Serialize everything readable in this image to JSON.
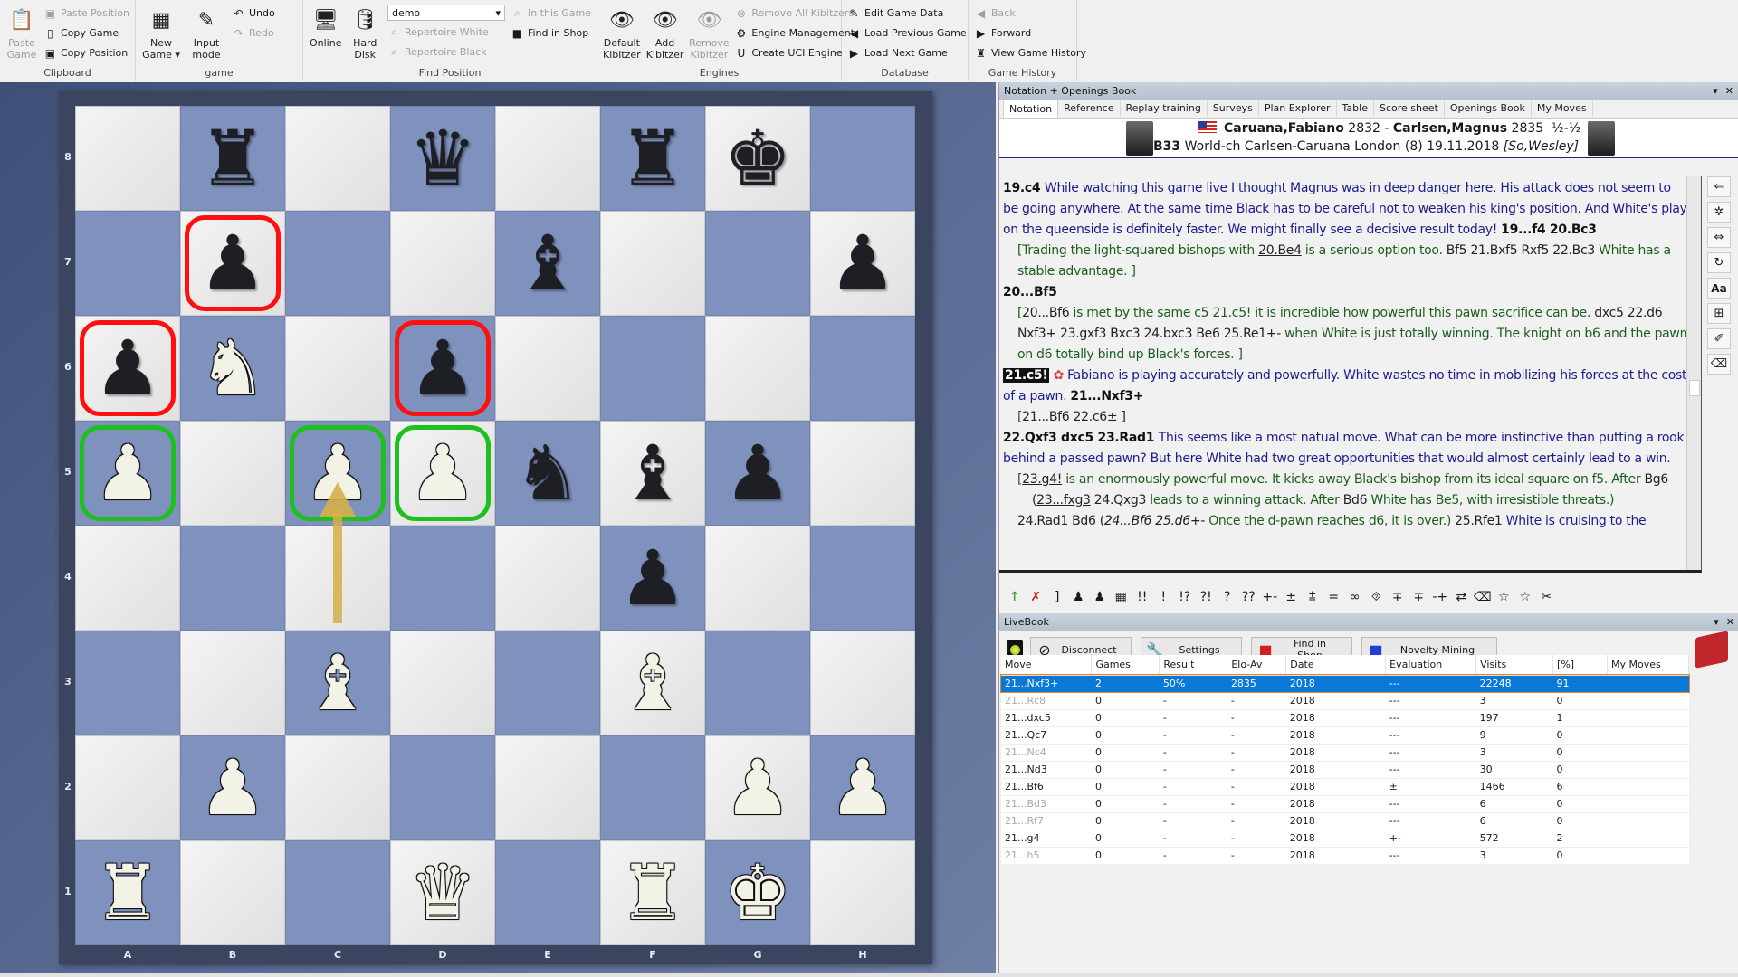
{
  "ribbon": {
    "groups": [
      {
        "label": "Clipboard",
        "big": [
          {
            "label1": "Paste",
            "label2": "Game",
            "icon": "clipboard-icon",
            "disabled": true
          }
        ],
        "small": [
          {
            "label": "Paste Position",
            "icon": "paste-position-icon",
            "disabled": true
          },
          {
            "label": "Copy Game",
            "icon": "copy-game-icon",
            "disabled": false
          },
          {
            "label": "Copy Position",
            "icon": "copy-position-icon",
            "disabled": false
          }
        ]
      },
      {
        "label": "game",
        "big": [
          {
            "label1": "New",
            "label2": "Game ▾",
            "icon": "chessboard-icon"
          },
          {
            "label1": "Input",
            "label2": "mode",
            "icon": "pencil-icon"
          }
        ],
        "small": [
          {
            "label": "Undo",
            "icon": "undo-icon",
            "disabled": false
          },
          {
            "label": "Redo",
            "icon": "redo-icon",
            "disabled": true
          }
        ]
      },
      {
        "label": "Find Position",
        "big": [
          {
            "label1": "Online",
            "label2": "",
            "icon": "online-search-icon"
          },
          {
            "label1": "Hard",
            "label2": "Disk",
            "icon": "disk-search-icon"
          }
        ],
        "combo": "demo",
        "small": [
          {
            "label": "Repertoire White",
            "icon": "repertoire-white-icon",
            "disabled": true
          },
          {
            "label": "Repertoire Black",
            "icon": "repertoire-black-icon",
            "disabled": true
          }
        ],
        "small2": [
          {
            "label": "In this Game",
            "icon": "in-game-search-icon",
            "disabled": true
          },
          {
            "label": "Find in Shop",
            "icon": "shop-icon",
            "disabled": false
          }
        ]
      },
      {
        "label": "Engines",
        "big": [
          {
            "label1": "Default",
            "label2": "Kibitzer",
            "icon": "kibitzer-icon"
          },
          {
            "label1": "Add",
            "label2": "Kibitzer",
            "icon": "add-kibitzer-icon"
          },
          {
            "label1": "Remove",
            "label2": "Kibitzer",
            "icon": "remove-kibitzer-icon",
            "disabled": true
          }
        ],
        "small": [
          {
            "label": "Remove All Kibitzers",
            "icon": "remove-all-icon",
            "disabled": true
          },
          {
            "label": "Engine Management",
            "icon": "engine-icon",
            "disabled": false
          },
          {
            "label": "Create UCI Engine",
            "icon": "uci-icon",
            "disabled": false
          }
        ]
      },
      {
        "label": "Database",
        "small": [
          {
            "label": "Edit Game Data",
            "icon": "edit-icon"
          },
          {
            "label": "Load Previous Game",
            "icon": "prev-icon"
          },
          {
            "label": "Load Next Game",
            "icon": "next-icon"
          }
        ]
      },
      {
        "label": "Game History",
        "small": [
          {
            "label": "Back",
            "icon": "back-icon",
            "disabled": true
          },
          {
            "label": "Forward",
            "icon": "forward-icon",
            "disabled": false
          },
          {
            "label": "View Game History",
            "icon": "history-icon",
            "disabled": false
          }
        ]
      }
    ]
  },
  "board": {
    "ranks": [
      "8",
      "7",
      "6",
      "5",
      "4",
      "3",
      "2",
      "1"
    ],
    "files": [
      "A",
      "B",
      "C",
      "D",
      "E",
      "F",
      "G",
      "H"
    ],
    "position": [
      [
        "",
        "r",
        "",
        "q",
        "",
        "r",
        "k",
        ""
      ],
      [
        "",
        "p",
        "",
        "",
        "b",
        "",
        "",
        "p"
      ],
      [
        "p",
        "N",
        "",
        "p",
        "",
        "",
        "",
        ""
      ],
      [
        "P",
        "",
        "P",
        "P",
        "n",
        "b",
        "p",
        ""
      ],
      [
        "",
        "",
        "",
        "",
        "",
        "p",
        "",
        ""
      ],
      [
        "",
        "",
        "B",
        "",
        "",
        "B",
        "",
        ""
      ],
      [
        "",
        "P",
        "",
        "",
        "",
        "",
        "P",
        "P"
      ],
      [
        "R",
        "",
        "",
        "Q",
        "",
        "R",
        "K",
        ""
      ]
    ],
    "highlights": [
      {
        "square": "b7",
        "color": "red"
      },
      {
        "square": "a6",
        "color": "red"
      },
      {
        "square": "d6",
        "color": "red"
      },
      {
        "square": "a5",
        "color": "green"
      },
      {
        "square": "c5",
        "color": "green"
      },
      {
        "square": "d5",
        "color": "green"
      }
    ],
    "arrow": {
      "from": "c4",
      "to": "c5",
      "color": "#d4b04a"
    }
  },
  "notation_panel": {
    "title": "Notation + Openings Book",
    "tabs": [
      "Notation",
      "Reference",
      "Replay training",
      "Surveys",
      "Plan Explorer",
      "Table",
      "Score sheet",
      "Openings Book",
      "My Moves"
    ],
    "active_tab": "Notation",
    "white": "Caruana,Fabiano",
    "white_elo": "2832",
    "black": "Carlsen,Magnus",
    "black_elo": "2835",
    "result": "½-½",
    "eco": "B33",
    "event": "World-ch Carlsen-Caruana London (8) 19.11.2018",
    "annotator": "[So,Wesley]"
  },
  "notation_lines": [
    {
      "cls": "",
      "parts": [
        {
          "t": "19.c4 ",
          "k": "mv"
        },
        {
          "t": "While watching this game live I thought Magnus was in deep danger here. His attack does not seem to be going anywhere. At the same time Black has to be careful not to weaken his king's position. And White's play on the queenside is definitely faster. We might finally see a decisive result today! ",
          "k": "c"
        },
        {
          "t": "19...f4  20.Bc3",
          "k": "mv"
        }
      ]
    },
    {
      "cls": "ind",
      "parts": [
        {
          "t": "[Trading the light-squared bishops with ",
          "k": "v"
        },
        {
          "t": "20.Be4",
          "k": "vm ul"
        },
        {
          "t": " is a serious option too. ",
          "k": "v"
        },
        {
          "t": " Bf5  21.Bxf5  Rxf5  22.Bc3",
          "k": "vm"
        },
        {
          "t": " White has a stable advantage. ]",
          "k": "v"
        }
      ]
    },
    {
      "cls": "",
      "parts": [
        {
          "t": "20...Bf5",
          "k": "mv"
        }
      ]
    },
    {
      "cls": "ind",
      "parts": [
        {
          "t": "[",
          "k": "v"
        },
        {
          "t": "20...Bf6",
          "k": "vm ul"
        },
        {
          "t": " is met by the same c5  21.c5! it is incredible how powerful this pawn sacrifice can be. ",
          "k": "v"
        },
        {
          "t": " dxc5  22.d6  Nxf3+  23.gxf3  Bxc3  24.bxc3  Be6  25.Re1+- ",
          "k": "vm"
        },
        {
          "t": "when White is just totally winning. The knight on b6 and the pawn on d6 totally bind up Black's forces. ]",
          "k": "v"
        }
      ]
    },
    {
      "cls": "",
      "parts": [
        {
          "t": "21.c5!",
          "k": "cur"
        },
        {
          "t": " ✿ ",
          "k": "ring"
        },
        {
          "t": "Fabiano is playing accurately and powerfully. White wastes no time in mobilizing his forces at the cost of a pawn. ",
          "k": "c"
        },
        {
          "t": " 21...Nxf3+",
          "k": "mv"
        }
      ]
    },
    {
      "cls": "ind",
      "parts": [
        {
          "t": "[",
          "k": "v"
        },
        {
          "t": "21...Bf6",
          "k": "vm ul"
        },
        {
          "t": "  22.c6± ]",
          "k": "vm"
        }
      ]
    },
    {
      "cls": "",
      "parts": [
        {
          "t": "22.Qxf3  dxc5  23.Rad1 ",
          "k": "mv"
        },
        {
          "t": "This seems like a most natual move. What can be more instinctive than putting a rook behind a passed pawn? But here White had two great opportunities that would almost certainly lead to a win.",
          "k": "c"
        }
      ]
    },
    {
      "cls": "ind",
      "parts": [
        {
          "t": "[",
          "k": "v"
        },
        {
          "t": "23.g4!",
          "k": "vm ul"
        },
        {
          "t": " is an enormously powerful move. It kicks away Black's bishop from its ideal square on f5. After ",
          "k": "v"
        },
        {
          "t": " Bg6",
          "k": "vm"
        }
      ]
    },
    {
      "cls": "ind2",
      "parts": [
        {
          "t": "(",
          "k": "vm"
        },
        {
          "t": "23...fxg3",
          "k": "vm ul"
        },
        {
          "t": "  24.Qxg3 ",
          "k": "vm"
        },
        {
          "t": "leads to a winning attack. After ",
          "k": "v"
        },
        {
          "t": " Bd6 ",
          "k": "vm"
        },
        {
          "t": "White has Be5, with irresistible threats.)",
          "k": "v"
        }
      ]
    },
    {
      "cls": "ind",
      "parts": [
        {
          "t": "24.Rad1  Bd6  (",
          "k": "vm"
        },
        {
          "t": "24...Bf6",
          "k": "vm ul it"
        },
        {
          "t": "  25.d6+- ",
          "k": "vm it"
        },
        {
          "t": "Once the d-pawn reaches d6, it is over.) ",
          "k": "v"
        },
        {
          "t": "25.Rfe1 ",
          "k": "vm"
        },
        {
          "t": "White is cruising to the",
          "k": "c"
        }
      ]
    }
  ],
  "side_tools": [
    "move-left-icon",
    "shuffle-icon",
    "move-both-icon",
    "refresh-icon",
    "font-icon",
    "tree-icon",
    "brush-icon",
    "eraser-icon"
  ],
  "annotation_toolbar": [
    "↑",
    "✗",
    "]",
    "♟",
    "♟",
    "▦",
    "!!",
    "!",
    "!?",
    "?!",
    "?",
    "??",
    "+-",
    "±",
    "⩲",
    "=",
    "∞",
    "⯑",
    "∓",
    "∓",
    "-+",
    "⇄",
    "⌫",
    "☆",
    "☆",
    "✂"
  ],
  "livebook": {
    "title": "LiveBook",
    "buttons": [
      {
        "label": "Disconnect",
        "icon": "disconnect-icon"
      },
      {
        "label": "Settings",
        "icon": "wrench-icon"
      },
      {
        "label": "Find in Shop",
        "icon": "shop-icon"
      },
      {
        "label": "Novelty Mining",
        "icon": "novelty-icon"
      }
    ],
    "columns": [
      "Move",
      "Games",
      "Result",
      "Elo-Av",
      "Date",
      "Evaluation",
      "Visits",
      "[%]",
      "My Moves"
    ],
    "rows": [
      {
        "move": "21...Nxf3+",
        "games": "2",
        "result": "50%",
        "elo": "2835",
        "date": "2018",
        "eval": "---",
        "visits": "22248",
        "pct": "91",
        "my": "",
        "selected": true,
        "grey": false
      },
      {
        "move": "21...Rc8",
        "games": "0",
        "result": "-",
        "elo": "-",
        "date": "2018",
        "eval": "---",
        "visits": "3",
        "pct": "0",
        "my": "",
        "grey": true
      },
      {
        "move": "21...dxc5",
        "games": "0",
        "result": "-",
        "elo": "-",
        "date": "2018",
        "eval": "---",
        "visits": "197",
        "pct": "1",
        "my": "",
        "grey": false
      },
      {
        "move": "21...Qc7",
        "games": "0",
        "result": "-",
        "elo": "-",
        "date": "2018",
        "eval": "---",
        "visits": "9",
        "pct": "0",
        "my": "",
        "grey": false
      },
      {
        "move": "21...Nc4",
        "games": "0",
        "result": "-",
        "elo": "-",
        "date": "2018",
        "eval": "---",
        "visits": "3",
        "pct": "0",
        "my": "",
        "grey": true
      },
      {
        "move": "21...Nd3",
        "games": "0",
        "result": "-",
        "elo": "-",
        "date": "2018",
        "eval": "---",
        "visits": "30",
        "pct": "0",
        "my": "",
        "grey": false
      },
      {
        "move": "21...Bf6",
        "games": "0",
        "result": "-",
        "elo": "-",
        "date": "2018",
        "eval": "±",
        "visits": "1466",
        "pct": "6",
        "my": "",
        "grey": false
      },
      {
        "move": "21...Bd3",
        "games": "0",
        "result": "-",
        "elo": "-",
        "date": "2018",
        "eval": "---",
        "visits": "6",
        "pct": "0",
        "my": "",
        "grey": true
      },
      {
        "move": "21...Rf7",
        "games": "0",
        "result": "-",
        "elo": "-",
        "date": "2018",
        "eval": "---",
        "visits": "6",
        "pct": "0",
        "my": "",
        "grey": true
      },
      {
        "move": "21...g4",
        "games": "0",
        "result": "-",
        "elo": "-",
        "date": "2018",
        "eval": "+-",
        "visits": "572",
        "pct": "2",
        "my": "",
        "grey": false
      },
      {
        "move": "21...h5",
        "games": "0",
        "result": "-",
        "elo": "-",
        "date": "2018",
        "eval": "---",
        "visits": "3",
        "pct": "0",
        "my": "",
        "grey": true
      }
    ]
  },
  "colors": {
    "light_square": "#ececec",
    "dark_square": "#7f91bd",
    "selection": "#0a78d7",
    "comment": "#1c1c8c",
    "variation": "#1c5e1c"
  }
}
